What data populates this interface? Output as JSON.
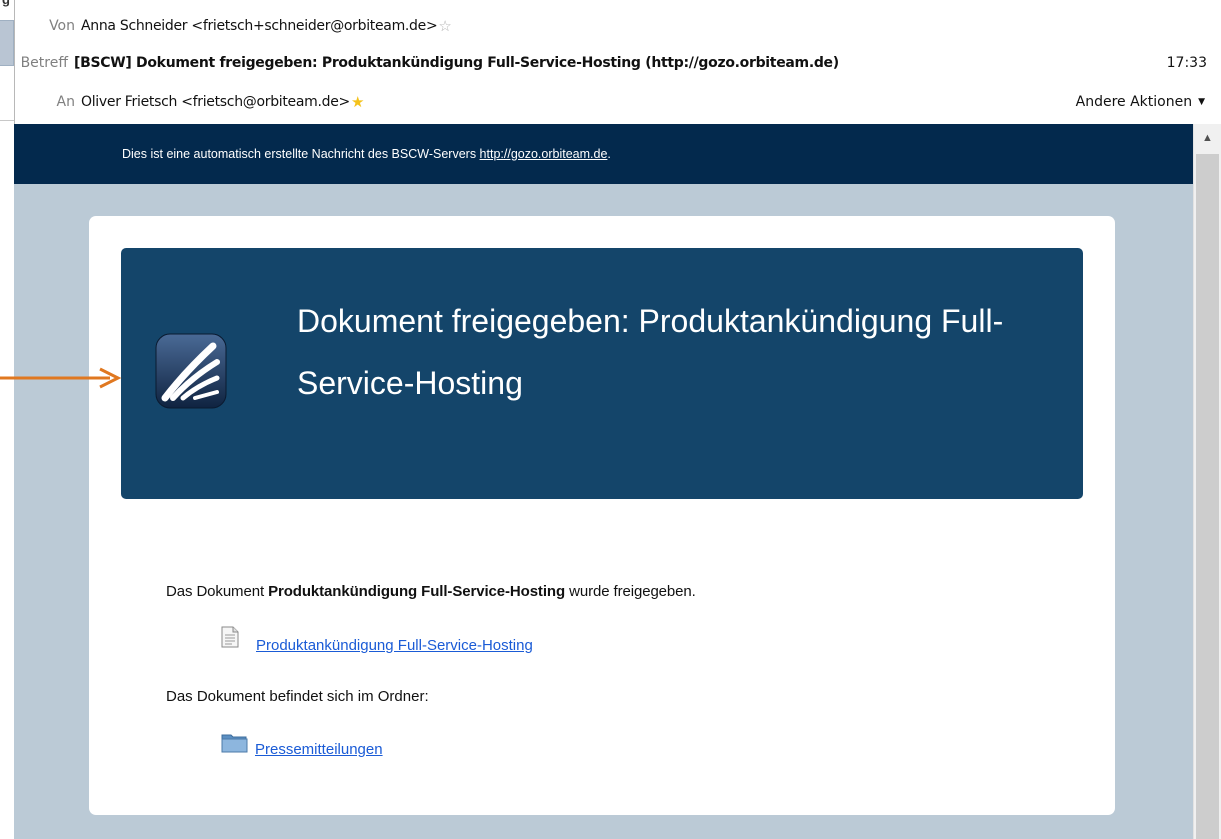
{
  "left_edge": {
    "top_fragment": "g"
  },
  "header": {
    "from": {
      "label": "Von",
      "value": "Anna Schneider <frietsch+schneider@orbiteam.de>"
    },
    "subject": {
      "label": "Betreff",
      "value": "[BSCW] Dokument freigegeben: Produktankündigung Full-Service-Hosting (http://gozo.orbiteam.de)",
      "time": "17:33"
    },
    "to": {
      "label": "An",
      "value": "Oliver Frietsch <frietsch@orbiteam.de>"
    },
    "more_actions": "Andere Aktionen"
  },
  "message": {
    "notice_text": "Dies ist eine automatisch erstellte Nachricht des BSCW-Servers ",
    "notice_link": "http://gozo.orbiteam.de",
    "notice_end": ".",
    "banner_title": "Dokument freigegeben: Produktankündigung Full-Service-Hosting",
    "doc_line_prefix": "Das Dokument ",
    "doc_name": "Produktankündigung Full-Service-Hosting",
    "doc_line_suffix": " wurde freigegeben.",
    "doc_link": "Produktankündigung Full-Service-Hosting",
    "folder_line": "Das Dokument befindet sich im Ordner:",
    "folder_link": "Pressemitteilungen"
  },
  "colors": {
    "notice_bar": "#03294d",
    "banner": "#14456a",
    "message_bg": "#bbcad6",
    "link": "#1a5bd6",
    "annotation_arrow": "#e07820",
    "star": "#f4c21a"
  },
  "icons": [
    "star-empty-icon",
    "star-icon",
    "caret-down-icon",
    "bscw-logo",
    "document-icon",
    "folder-icon",
    "scroll-up-arrow-icon",
    "annotation-arrow"
  ]
}
